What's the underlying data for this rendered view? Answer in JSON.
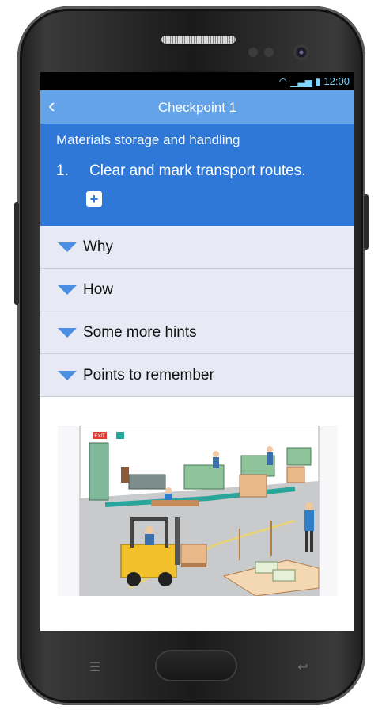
{
  "status_bar": {
    "time": "12:00",
    "icons": [
      "wifi-icon",
      "signal-icon",
      "battery-icon"
    ]
  },
  "app_bar": {
    "back_icon": "chevron-left-icon",
    "title": "Checkpoint 1"
  },
  "header": {
    "category": "Materials storage and handling",
    "item_number": "1.",
    "item_text": "Clear and mark transport routes.",
    "add_icon": "plus-icon"
  },
  "accordion": [
    {
      "label": "Why"
    },
    {
      "label": "How"
    },
    {
      "label": "Some more hints"
    },
    {
      "label": "Points to remember"
    }
  ],
  "illustration": {
    "exit_sign": "EXIT",
    "content": "warehouse forklift transport route illustration"
  },
  "colors": {
    "app_bar": "#64a3e8",
    "header": "#2f78d8",
    "accordion_bg": "#e7eaf4",
    "triangle": "#4b8fe3"
  }
}
